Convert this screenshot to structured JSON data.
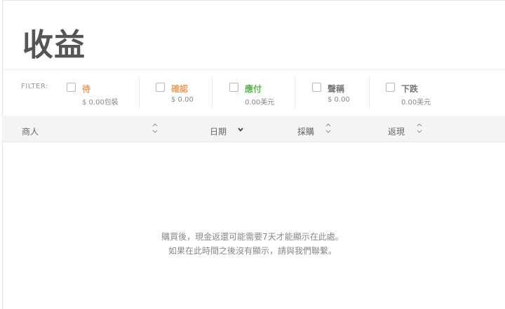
{
  "page": {
    "title": "收益"
  },
  "filter": {
    "label": "FILTER:",
    "items": [
      {
        "name": "待",
        "amount": "$ 0.00包裝",
        "color": "#e8a060"
      },
      {
        "name": "確認",
        "amount": "$ 0.00",
        "color": "#e8a060"
      },
      {
        "name": "應付",
        "amount": "0.00美元",
        "color": "#5ab552"
      },
      {
        "name": "聲稱",
        "amount": "$ 0.00",
        "color": "#777777"
      },
      {
        "name": "下跌",
        "amount": "0.00美元",
        "color": "#777777"
      }
    ]
  },
  "table": {
    "columns": [
      {
        "label": "商人",
        "sort_icon": "sort-updown-icon"
      },
      {
        "label": "日期",
        "sort_icon": "chevron-down-icon"
      },
      {
        "label": "採購",
        "sort_icon": "sort-updown-icon"
      },
      {
        "label": "返現",
        "sort_icon": "sort-updown-icon"
      }
    ]
  },
  "empty_state": {
    "line1": "購買後，現金返還可能需要7天才能顯示在此處。",
    "line2": "如果在此時間之後沒有顯示，請與我們聯繫。"
  }
}
